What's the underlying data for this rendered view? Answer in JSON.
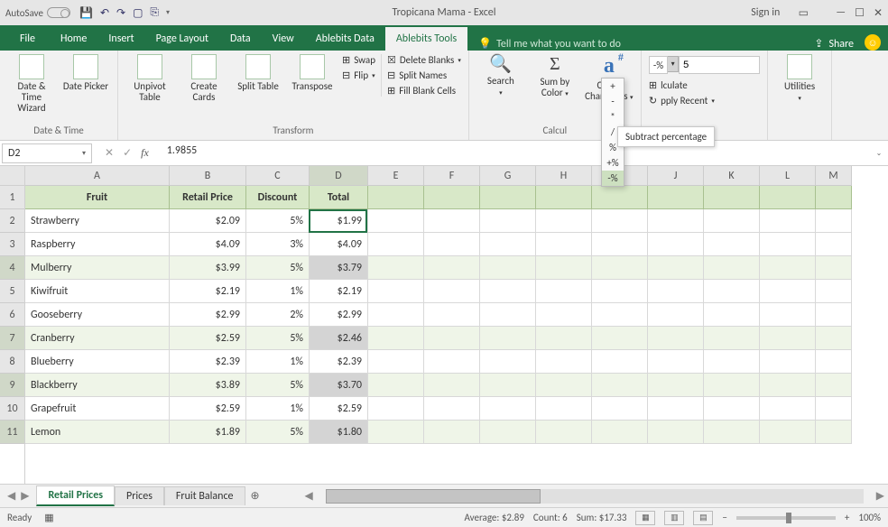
{
  "titlebar": {
    "autosave": "AutoSave",
    "doc_title": "Tropicana Mama  -  Excel",
    "signin": "Sign in"
  },
  "tabs": {
    "file": "File",
    "home": "Home",
    "insert": "Insert",
    "pagelayout": "Page Layout",
    "data": "Data",
    "view": "View",
    "abledata": "Ablebits Data",
    "abletools": "Ablebits Tools",
    "tellme": "Tell me what you want to do",
    "share": "Share"
  },
  "ribbon": {
    "datetimewiz": "Date & Time Wizard",
    "datepicker": "Date Picker",
    "g_datetime": "Date & Time",
    "unpivot": "Unpivot Table",
    "createcards": "Create Cards",
    "splittable": "Split Table",
    "transpose": "Transpose",
    "swap": "Swap",
    "flip": "Flip",
    "g_transform": "Transform",
    "delblanks": "Delete Blanks",
    "splitnames": "Split Names",
    "fillblanks": "Fill Blank Cells",
    "search": "Search",
    "sumbycolor": "Sum by Color",
    "countchars": "Count Characters",
    "lculate": "lculate",
    "applyrecent": "pply Recent",
    "g_calc": "Calcul",
    "utilities": "Utilities",
    "op_label": "-%",
    "op_value": "5",
    "op_menu": [
      "+",
      "-",
      "*",
      "/",
      "%",
      "+%",
      "-%"
    ],
    "tooltip": "Subtract percentage"
  },
  "formulabar": {
    "namebox": "D2",
    "formula": "1.9855"
  },
  "columns": [
    "A",
    "B",
    "C",
    "D",
    "E",
    "F",
    "G",
    "H",
    "I",
    "J",
    "K",
    "L",
    "M"
  ],
  "header_row": {
    "A": "Fruit",
    "B": "Retail Price",
    "C": "Discount",
    "D": "Total"
  },
  "rows": [
    {
      "n": 2,
      "f": "Strawberry",
      "p": "$2.09",
      "d": "5%",
      "t": "$1.99",
      "band": false,
      "sel": false
    },
    {
      "n": 3,
      "f": "Raspberry",
      "p": "$4.09",
      "d": "3%",
      "t": "$4.09",
      "band": false,
      "sel": false
    },
    {
      "n": 4,
      "f": "Mulberry",
      "p": "$3.99",
      "d": "5%",
      "t": "$3.79",
      "band": true,
      "sel": true
    },
    {
      "n": 5,
      "f": "Kiwifruit",
      "p": "$2.19",
      "d": "1%",
      "t": "$2.19",
      "band": false,
      "sel": false
    },
    {
      "n": 6,
      "f": "Gooseberry",
      "p": "$2.99",
      "d": "2%",
      "t": "$2.99",
      "band": false,
      "sel": false
    },
    {
      "n": 7,
      "f": "Cranberry",
      "p": "$2.59",
      "d": "5%",
      "t": "$2.46",
      "band": true,
      "sel": true
    },
    {
      "n": 8,
      "f": "Blueberry",
      "p": "$2.39",
      "d": "1%",
      "t": "$2.39",
      "band": false,
      "sel": false
    },
    {
      "n": 9,
      "f": "Blackberry",
      "p": "$3.89",
      "d": "5%",
      "t": "$3.70",
      "band": true,
      "sel": true
    },
    {
      "n": 10,
      "f": "Grapefruit",
      "p": "$2.59",
      "d": "1%",
      "t": "$2.59",
      "band": false,
      "sel": false
    },
    {
      "n": 11,
      "f": "Lemon",
      "p": "$1.89",
      "d": "5%",
      "t": "$1.80",
      "band": true,
      "sel": true
    }
  ],
  "sheets": {
    "s1": "Retail Prices",
    "s2": "Prices",
    "s3": "Fruit Balance"
  },
  "status": {
    "ready": "Ready",
    "avg": "Average: $2.89",
    "count": "Count: 6",
    "sum": "Sum: $17.33",
    "zoom": "100%"
  }
}
